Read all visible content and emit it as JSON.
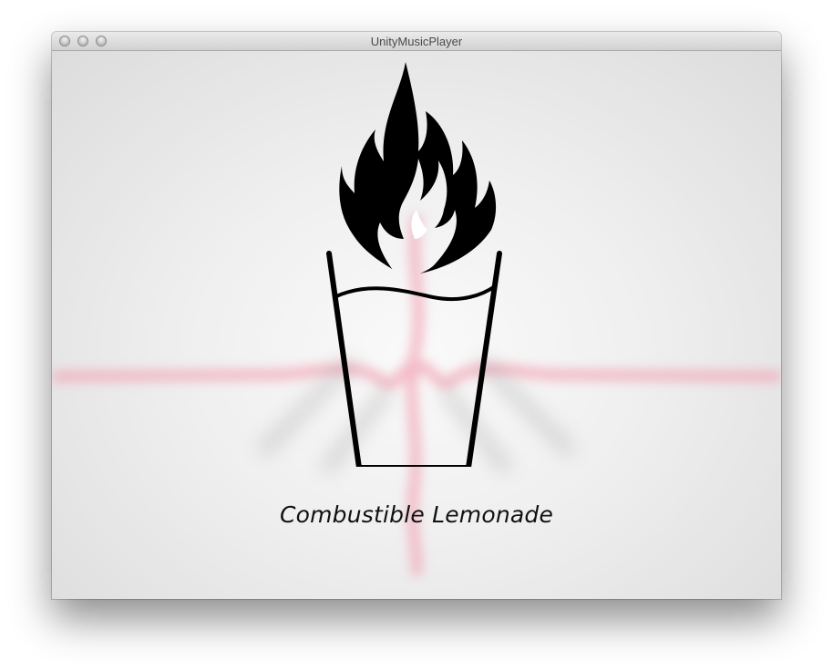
{
  "window": {
    "title": "UnityMusicPlayer"
  },
  "controls": {
    "close_icon": "close-circle",
    "minimize_icon": "minimize-circle",
    "zoom_icon": "zoom-circle"
  },
  "player": {
    "track_title": "Combustible Lemonade",
    "logo_icon": "flaming-lemonade-glass-icon"
  },
  "colors": {
    "visualizer_accent": "#f2a6b8",
    "logo": "#000000",
    "background": "#f4f4f4"
  }
}
